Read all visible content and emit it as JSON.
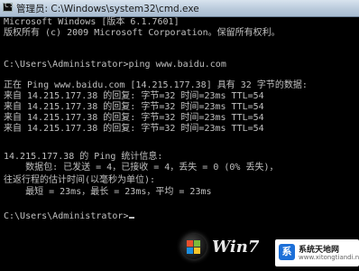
{
  "window": {
    "title": "管理员: C:\\Windows\\system32\\cmd.exe"
  },
  "console": {
    "lines": [
      "Microsoft Windows [版本 6.1.7601]",
      "版权所有 (c) 2009 Microsoft Corporation。保留所有权利。",
      "",
      "C:\\Users\\Administrator>ping www.baidu.com",
      "",
      "正在 Ping www.baidu.com [14.215.177.38] 具有 32 字节的数据:",
      "来自 14.215.177.38 的回复: 字节=32 时间=23ms TTL=54",
      "来自 14.215.177.38 的回复: 字节=32 时间=23ms TTL=54",
      "来自 14.215.177.38 的回复: 字节=32 时间=23ms TTL=54",
      "来自 14.215.177.38 的回复: 字节=32 时间=23ms TTL=54",
      "",
      "14.215.177.38 的 Ping 统计信息:",
      "    数据包: 已发送 = 4，已接收 = 4，丢失 = 0 (0% 丢失)，",
      "往返行程的估计时间(以毫秒为单位):",
      "    最短 = 23ms，最长 = 23ms，平均 = 23ms",
      "",
      "C:\\Users\\Administrator>"
    ]
  },
  "watermark": {
    "logo_text": "Win7"
  },
  "badge": {
    "icon_letter": "系",
    "title": "系统天地网",
    "subtitle": "www.xitongtiandi.net"
  }
}
